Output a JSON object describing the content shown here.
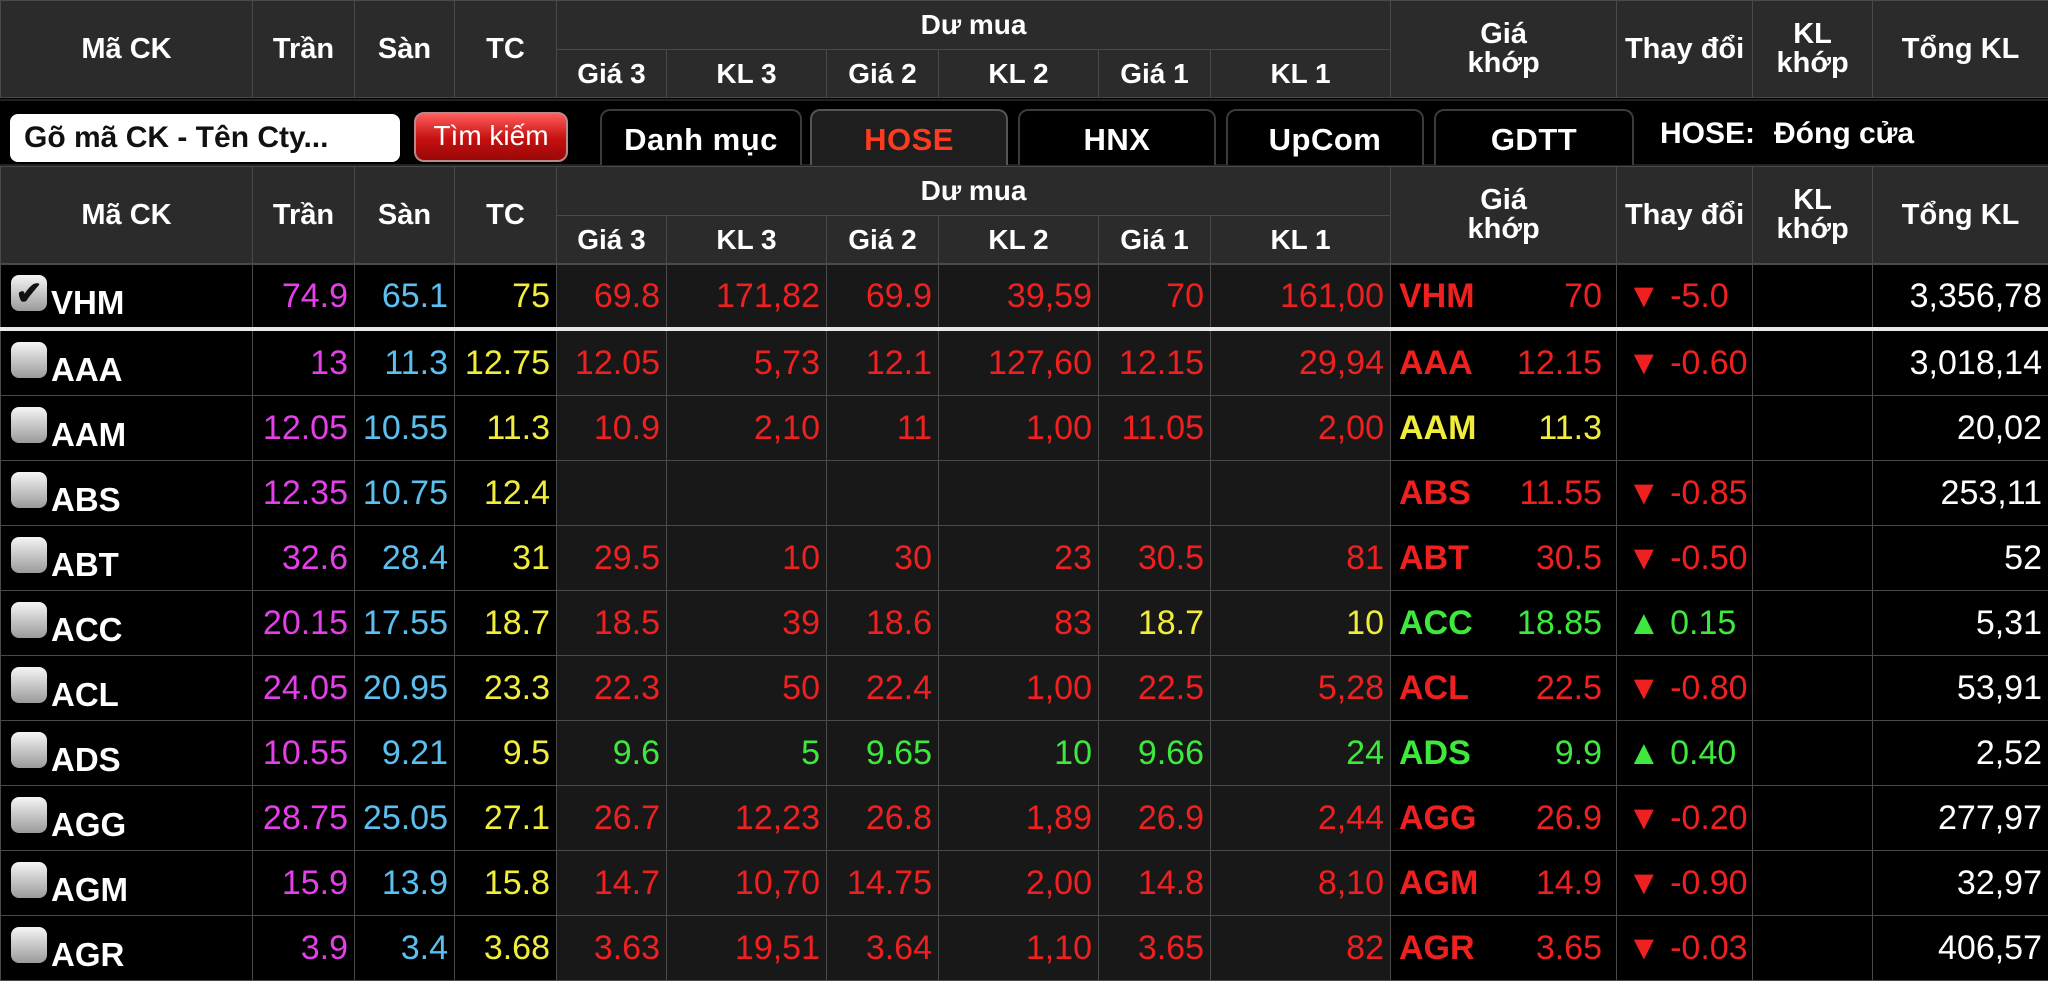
{
  "colors": {
    "ceil": "#e43fe8",
    "floor": "#5bc0f0",
    "ref": "#f0ed3c",
    "down": "#ee2020",
    "up": "#3ee83e",
    "white": "#ffffff",
    "active_tab": "#ff3b1f"
  },
  "headers": {
    "ma_ck": "Mã CK",
    "tran": "Trần",
    "san": "Sàn",
    "tc": "TC",
    "du_mua": "Dư mua",
    "gia3": "Giá 3",
    "kl3": "KL 3",
    "gia2": "Giá 2",
    "kl2": "KL 2",
    "gia1": "Giá 1",
    "kl1": "KL 1",
    "gia_khop_line1": "Giá",
    "gia_khop_line2": "khớp",
    "thay_doi": "Thay đổi",
    "kl_khop_line1": "KL",
    "kl_khop_line2": "khớp",
    "tong_kl": "Tổng KL"
  },
  "toolbar": {
    "search_placeholder": "Gõ mã CK - Tên Cty...",
    "search_button": "Tìm kiếm",
    "tabs": [
      "Danh mục",
      "HOSE",
      "HNX",
      "UpCom",
      "GDTT"
    ],
    "active_tab": "HOSE",
    "status_label": "HOSE:",
    "status_value": "Đóng cửa"
  },
  "rows": [
    {
      "sym": "VHM",
      "checked": true,
      "tran": "74.9",
      "san": "65.1",
      "tc": "75",
      "g3": "69.8",
      "k3": "171,82",
      "g2": "69.9",
      "k2": "39,59",
      "g1": "70",
      "k1": "161,00",
      "bid_color": "down",
      "match_sym": "VHM",
      "match": "70",
      "chg": "▼ -5.0",
      "match_color": "down",
      "total": "3,356,78"
    },
    {
      "sym": "AAA",
      "checked": false,
      "tran": "13",
      "san": "11.3",
      "tc": "12.75",
      "g3": "12.05",
      "k3": "5,73",
      "g2": "12.1",
      "k2": "127,60",
      "g1": "12.15",
      "k1": "29,94",
      "bid_color": "down",
      "match_sym": "AAA",
      "match": "12.15",
      "chg": "▼ -0.60",
      "match_color": "down",
      "total": "3,018,14"
    },
    {
      "sym": "AAM",
      "checked": false,
      "tran": "12.05",
      "san": "10.55",
      "tc": "11.3",
      "g3": "10.9",
      "k3": "2,10",
      "g2": "11",
      "k2": "1,00",
      "g1": "11.05",
      "k1": "2,00",
      "bid_color": "down",
      "match_sym": "AAM",
      "match": "11.3",
      "chg": "",
      "match_color": "ref",
      "total": "20,02"
    },
    {
      "sym": "ABS",
      "checked": false,
      "tran": "12.35",
      "san": "10.75",
      "tc": "12.4",
      "g3": "",
      "k3": "",
      "g2": "",
      "k2": "",
      "g1": "",
      "k1": "",
      "bid_color": "down",
      "match_sym": "ABS",
      "match": "11.55",
      "chg": "▼ -0.85",
      "match_color": "down",
      "total": "253,11"
    },
    {
      "sym": "ABT",
      "checked": false,
      "tran": "32.6",
      "san": "28.4",
      "tc": "31",
      "g3": "29.5",
      "k3": "10",
      "g2": "30",
      "k2": "23",
      "g1": "30.5",
      "k1": "81",
      "bid_color": "down",
      "match_sym": "ABT",
      "match": "30.5",
      "chg": "▼ -0.50",
      "match_color": "down",
      "total": "52"
    },
    {
      "sym": "ACC",
      "checked": false,
      "tran": "20.15",
      "san": "17.55",
      "tc": "18.7",
      "g3": "18.5",
      "k3": "39",
      "g2": "18.6",
      "k2": "83",
      "g1": "18.7",
      "k1": "10",
      "bid_color": "down",
      "g1_color": "ref",
      "match_sym": "ACC",
      "match": "18.85",
      "chg": "▲ 0.15",
      "match_color": "up",
      "total": "5,31"
    },
    {
      "sym": "ACL",
      "checked": false,
      "tran": "24.05",
      "san": "20.95",
      "tc": "23.3",
      "g3": "22.3",
      "k3": "50",
      "g2": "22.4",
      "k2": "1,00",
      "g1": "22.5",
      "k1": "5,28",
      "bid_color": "down",
      "match_sym": "ACL",
      "match": "22.5",
      "chg": "▼ -0.80",
      "match_color": "down",
      "total": "53,91"
    },
    {
      "sym": "ADS",
      "checked": false,
      "tran": "10.55",
      "san": "9.21",
      "tc": "9.5",
      "g3": "9.6",
      "k3": "5",
      "g2": "9.65",
      "k2": "10",
      "g1": "9.66",
      "k1": "24",
      "bid_color": "up",
      "match_sym": "ADS",
      "match": "9.9",
      "chg": "▲ 0.40",
      "match_color": "up",
      "total": "2,52"
    },
    {
      "sym": "AGG",
      "checked": false,
      "tran": "28.75",
      "san": "25.05",
      "tc": "27.1",
      "g3": "26.7",
      "k3": "12,23",
      "g2": "26.8",
      "k2": "1,89",
      "g1": "26.9",
      "k1": "2,44",
      "bid_color": "down",
      "match_sym": "AGG",
      "match": "26.9",
      "chg": "▼ -0.20",
      "match_color": "down",
      "total": "277,97"
    },
    {
      "sym": "AGM",
      "checked": false,
      "tran": "15.9",
      "san": "13.9",
      "tc": "15.8",
      "g3": "14.7",
      "k3": "10,70",
      "g2": "14.75",
      "k2": "2,00",
      "g1": "14.8",
      "k1": "8,10",
      "bid_color": "down",
      "match_sym": "AGM",
      "match": "14.9",
      "chg": "▼ -0.90",
      "match_color": "down",
      "total": "32,97"
    },
    {
      "sym": "AGR",
      "checked": false,
      "tran": "3.9",
      "san": "3.4",
      "tc": "3.68",
      "g3": "3.63",
      "k3": "19,51",
      "g2": "3.64",
      "k2": "1,10",
      "g1": "3.65",
      "k1": "82",
      "bid_color": "down",
      "match_sym": "AGR",
      "match": "3.65",
      "chg": "▼ -0.03",
      "match_color": "down",
      "total": "406,57"
    }
  ]
}
